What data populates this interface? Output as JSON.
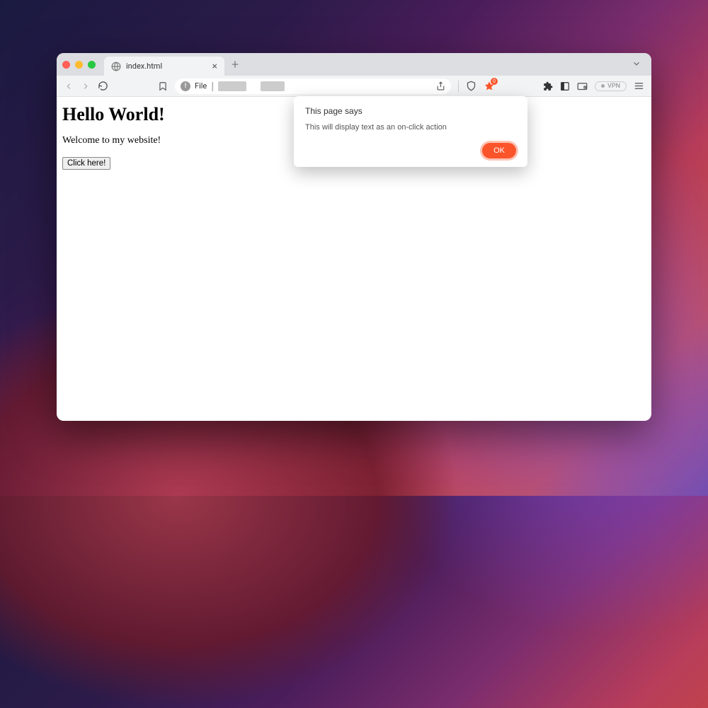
{
  "tab": {
    "title": "index.html"
  },
  "url": {
    "scheme": "File"
  },
  "vpn": {
    "label": "VPN"
  },
  "page": {
    "heading": "Hello World!",
    "welcome": "Welcome to my website!",
    "button_label": "Click here!"
  },
  "alert": {
    "title": "This page says",
    "message": "This will display text as an on-click action",
    "ok_label": "OK"
  },
  "brave": {
    "badge": "0"
  }
}
